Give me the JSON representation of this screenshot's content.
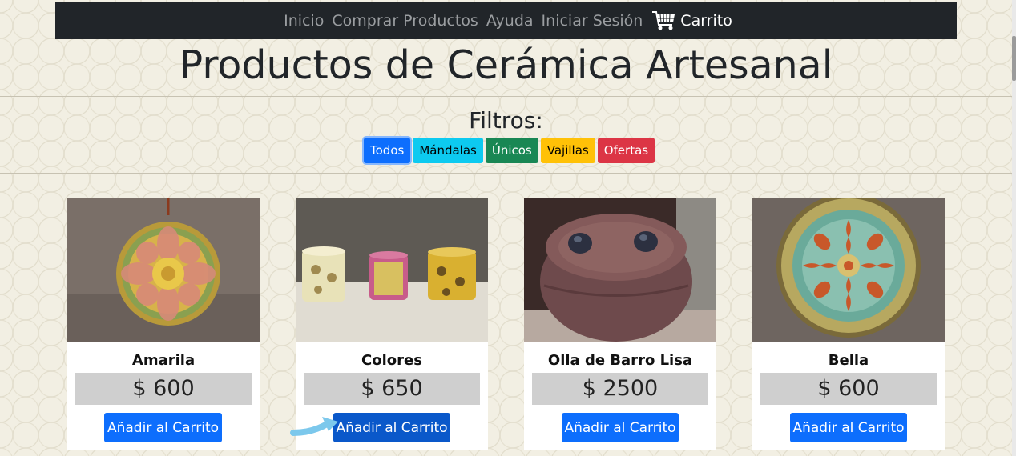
{
  "nav": {
    "items": [
      {
        "label": "Inicio"
      },
      {
        "label": "Comprar Productos"
      },
      {
        "label": "Ayuda"
      },
      {
        "label": "Iniciar Sesión"
      }
    ],
    "cart_label": "Carrito",
    "cart_icon": "shopping-cart-icon"
  },
  "page": {
    "title": "Productos de Cerámica Artesanal"
  },
  "filters": {
    "label": "Filtros:",
    "buttons": [
      {
        "label": "Todos",
        "color": "#0d6efd"
      },
      {
        "label": "Mándalas",
        "color": "#0dcaf0"
      },
      {
        "label": "Únicos",
        "color": "#198754"
      },
      {
        "label": "Vajillas",
        "color": "#ffc107"
      },
      {
        "label": "Ofertas",
        "color": "#dc3545"
      }
    ]
  },
  "products": [
    {
      "name": "Amarila",
      "price": "$ 600",
      "button": "Añadir al Carrito"
    },
    {
      "name": "Colores",
      "price": "$ 650",
      "button": "Añadir al Carrito"
    },
    {
      "name": "Olla de Barro Lisa",
      "price": "$ 2500",
      "button": "Añadir al Carrito"
    },
    {
      "name": "Bella",
      "price": "$ 600",
      "button": "Añadir al Carrito"
    }
  ]
}
